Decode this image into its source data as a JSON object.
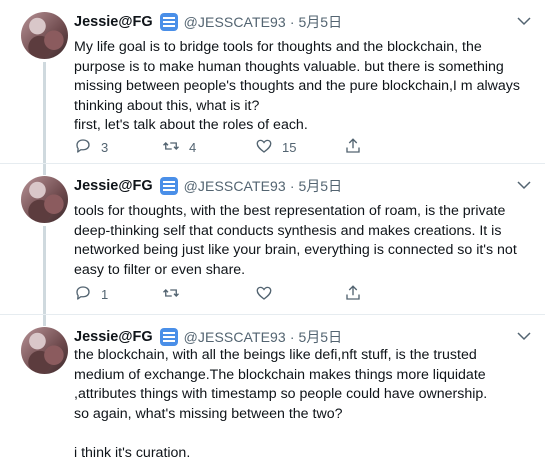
{
  "tweets": [
    {
      "name": "Jessie@FG",
      "handle": "@JESSCATE93",
      "separator": "·",
      "date": "5月5日",
      "text": "My life goal is to bridge tools for thoughts and the blockchain, the purpose is to make human thoughts valuable. but there is something missing between people's thoughts and the pure blockchain,I m always thinking about this, what is it?\nfirst, let's talk about the roles of each.",
      "replies": "3",
      "retweets": "4",
      "likes": "15"
    },
    {
      "name": "Jessie@FG",
      "handle": "@JESSCATE93",
      "separator": "·",
      "date": "5月5日",
      "text": "tools for thoughts, with the best representation of roam, is the private deep-thinking self that conducts synthesis and makes creations. It is networked being just like your brain, everything is connected so it's not easy to filter or even share.",
      "replies": "1",
      "retweets": "",
      "likes": ""
    },
    {
      "name": "Jessie@FG",
      "handle": "@JESSCATE93",
      "separator": "·",
      "date": "5月5日",
      "text": "the blockchain, with all the beings like defi,nft stuff, is the trusted medium of exchange.The blockchain makes things more liquidate ,attributes things with timestamp so people could have ownership.\nso again, what's missing between the two?\n\ni think it's curation.",
      "replies": "",
      "retweets": "",
      "likes": ""
    }
  ],
  "icons": {
    "reply": "reply-icon",
    "retweet": "retweet-icon",
    "like": "heart-icon",
    "share": "share-icon",
    "more": "chevron-down-icon",
    "badge": "verified-org-badge-icon"
  },
  "colors": {
    "text": "#0f1419",
    "muted": "#536471",
    "thread_line": "#cfd9de",
    "badge": "#4a8fe8"
  }
}
